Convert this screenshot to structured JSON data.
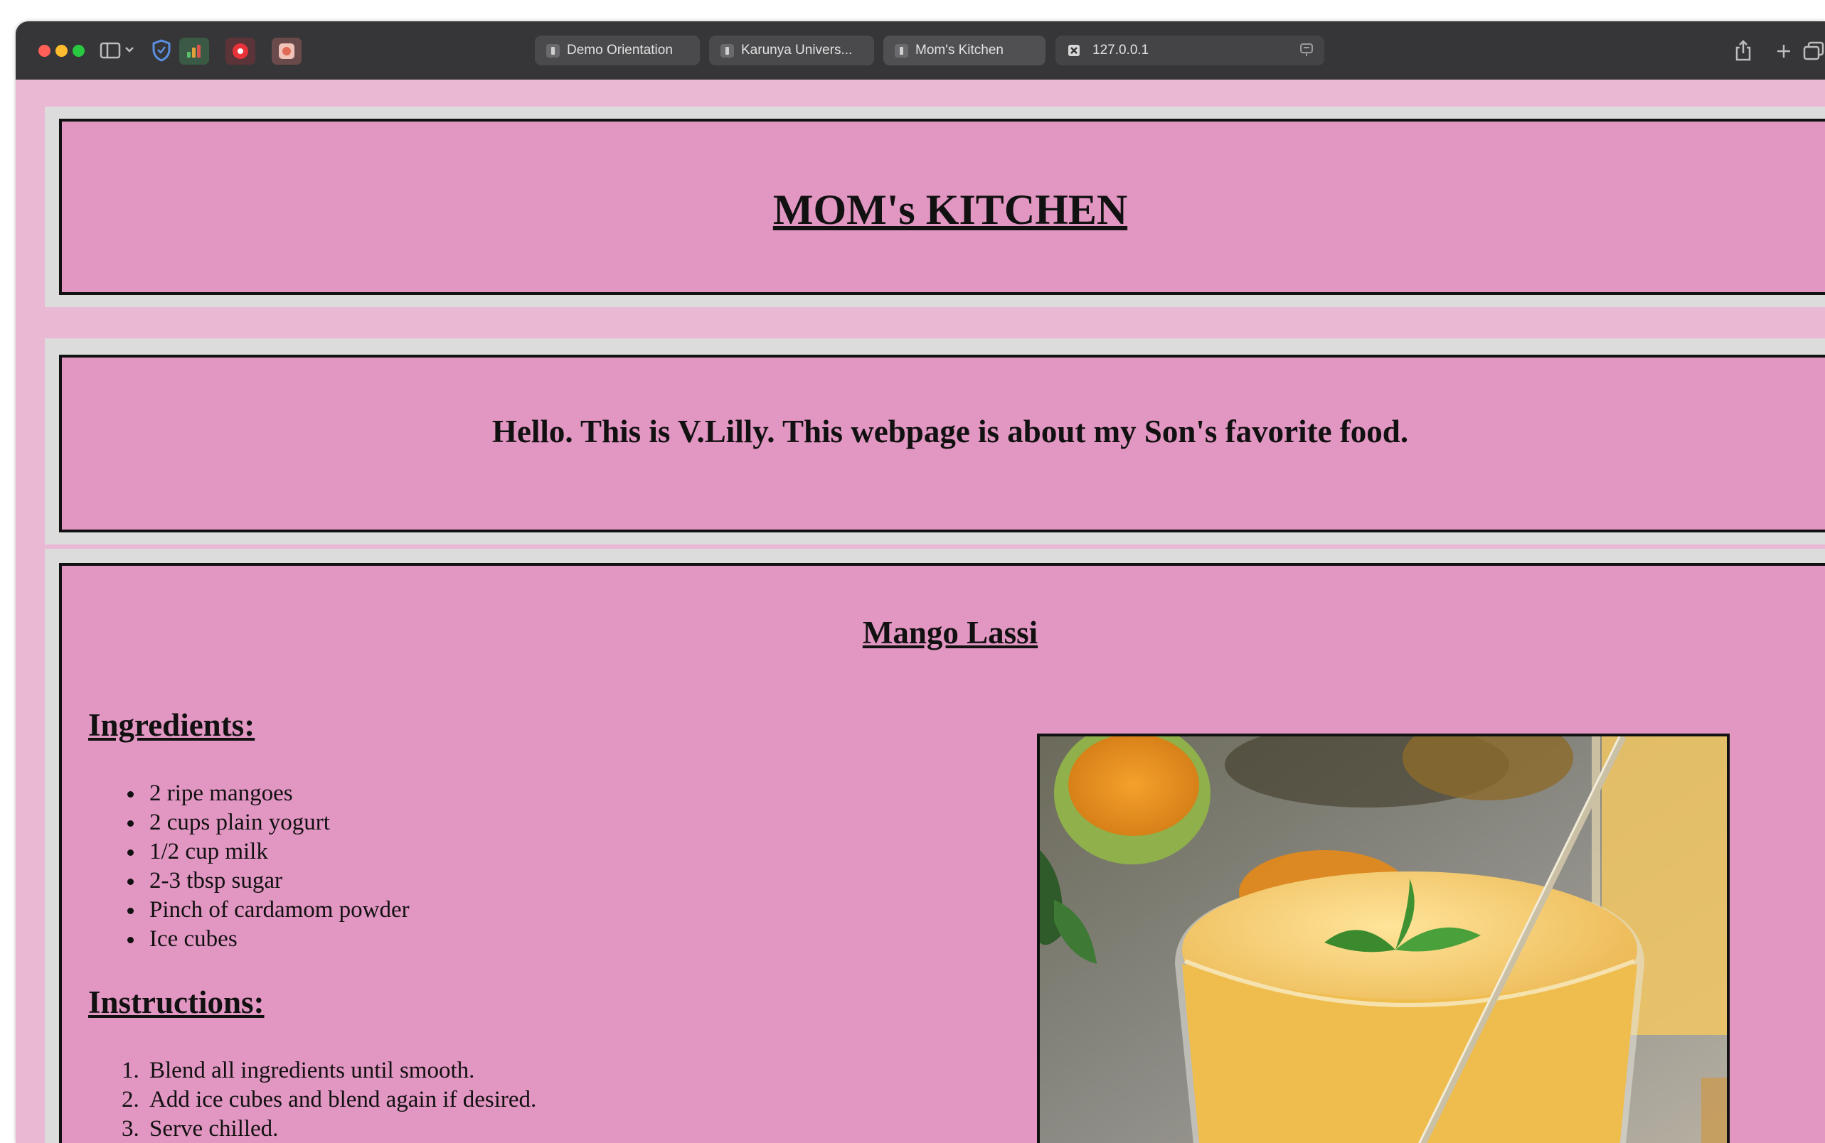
{
  "browser": {
    "tabs": [
      {
        "label": "Demo Orientation"
      },
      {
        "label": "Karunya Univers..."
      },
      {
        "label": "Mom's Kitchen"
      }
    ],
    "address": "127.0.0.1"
  },
  "page": {
    "title": "MOM's KITCHEN",
    "intro": "Hello. This is V.Lilly. This webpage is about my Son's favorite food.",
    "recipe": {
      "name": "Mango Lassi",
      "ingredients_heading": "Ingredients:",
      "ingredients": [
        "2 ripe mangoes",
        "2 cups plain yogurt",
        "1/2 cup milk",
        "2-3 tbsp sugar",
        "Pinch of cardamom powder",
        "Ice cubes"
      ],
      "instructions_heading": "Instructions:",
      "instructions": [
        "Blend all ingredients until smooth.",
        "Add ice cubes and blend again if desired.",
        "Serve chilled."
      ]
    }
  },
  "colors": {
    "page_background": "#e9b9d4",
    "box_background": "#e296c2",
    "frame": "#dcdcdc",
    "toolbar": "#363638"
  },
  "icons": [
    "sidebar-toggle-icon",
    "chevron-down-icon",
    "shield-icon",
    "share-icon",
    "new-tab-icon",
    "tab-overview-icon",
    "reader-icon",
    "close-icon"
  ]
}
